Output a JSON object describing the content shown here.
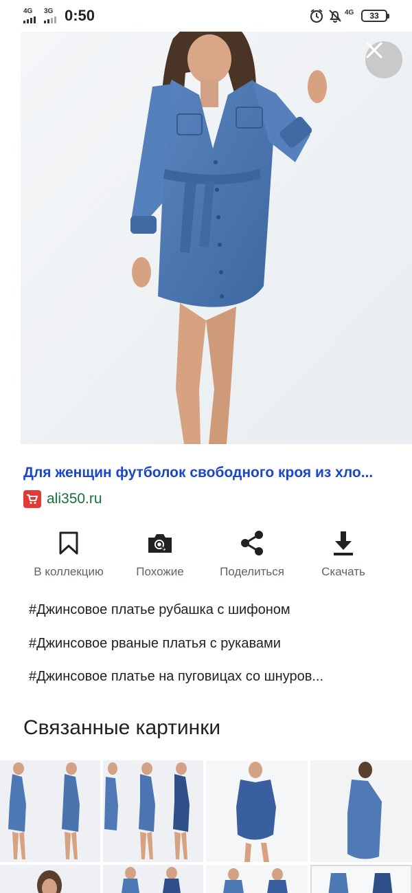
{
  "status_bar": {
    "network1": "4G",
    "network2": "3G",
    "time": "0:50",
    "network3": "4G",
    "battery": "33"
  },
  "result": {
    "title": "Для женщин футболок свободного кроя из хло...",
    "source": "ali350.ru"
  },
  "actions": [
    {
      "label": "В коллекцию",
      "icon": "bookmark-icon"
    },
    {
      "label": "Похожие",
      "icon": "lens-search-icon"
    },
    {
      "label": "Поделиться",
      "icon": "share-icon"
    },
    {
      "label": "Скачать",
      "icon": "download-icon"
    }
  ],
  "tags": [
    "#Джинсовое платье рубашка с шифоном",
    "#Джинсовое рваные платья с рукавами",
    "#Джинсовое платье на пуговицах со шнуров..."
  ],
  "related": {
    "title": "Связанные картинки"
  },
  "colors": {
    "link": "#1a47c8",
    "source": "#137333",
    "denim": "#4a72b0"
  }
}
